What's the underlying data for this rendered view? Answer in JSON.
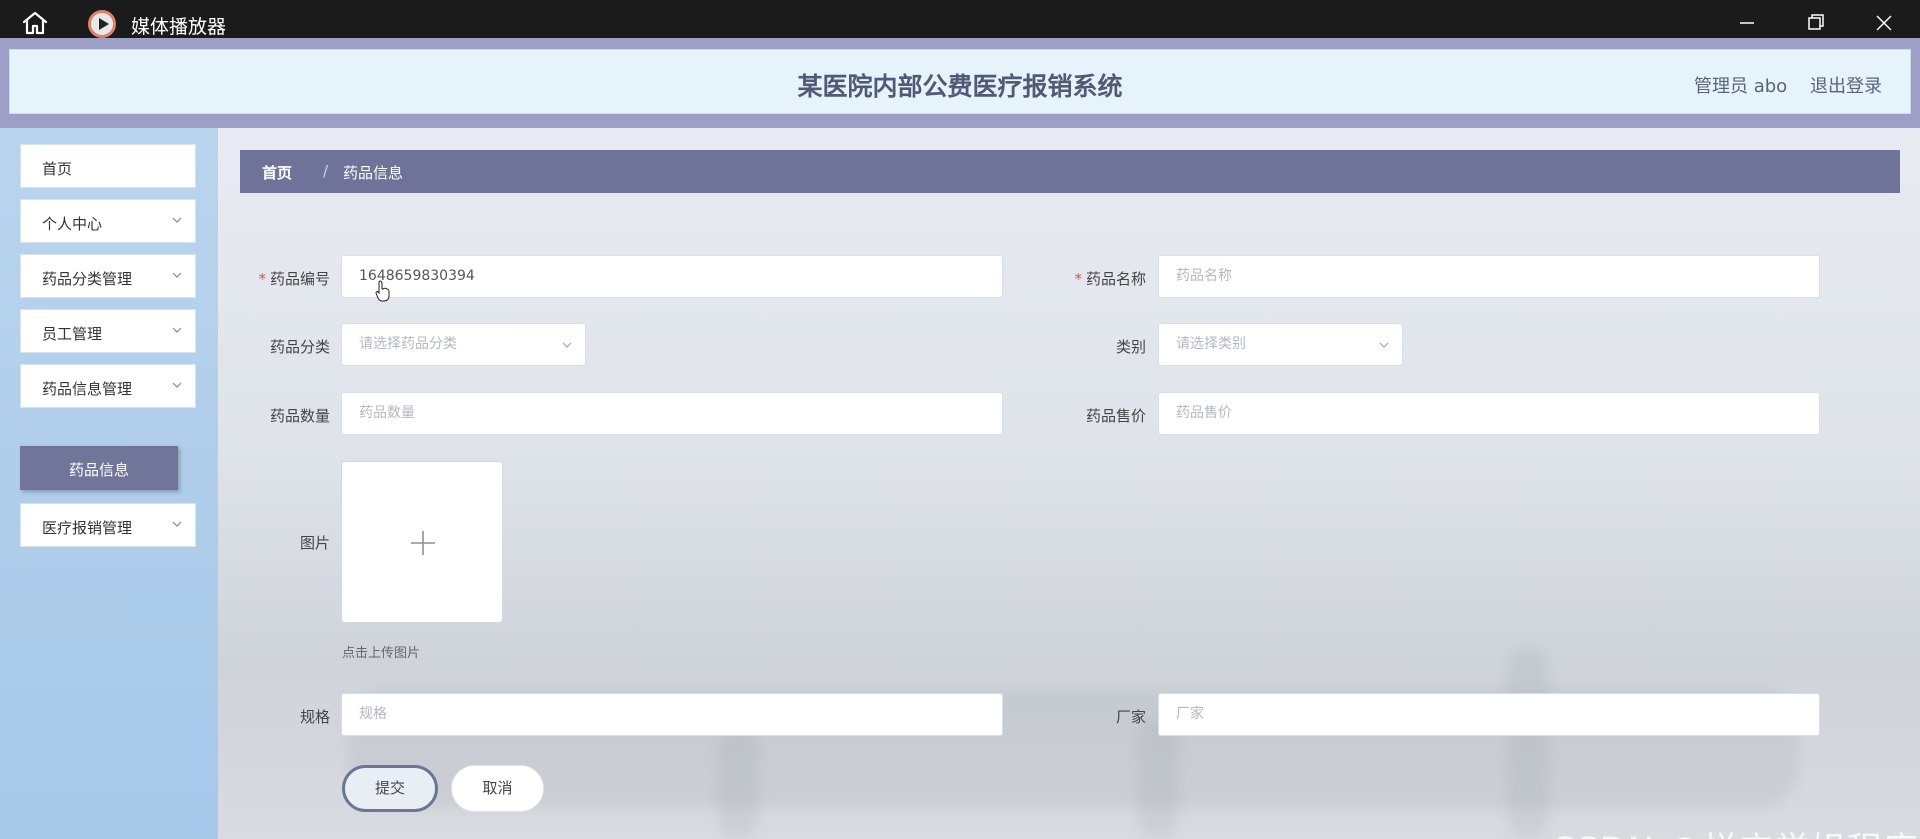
{
  "window": {
    "title": "媒体播放器",
    "icons": [
      "home-icon",
      "media-player-icon",
      "minimize-icon",
      "maximize-icon",
      "close-icon"
    ]
  },
  "header": {
    "title": "某医院内部公费医疗报销系统",
    "user": "管理员 abo",
    "logout": "退出登录"
  },
  "sidebar": {
    "items": [
      {
        "label": "首页",
        "has_children": false
      },
      {
        "label": "个人中心",
        "has_children": true
      },
      {
        "label": "药品分类管理",
        "has_children": true
      },
      {
        "label": "员工管理",
        "has_children": true
      },
      {
        "label": "药品信息管理",
        "has_children": true
      },
      {
        "label": "医疗报销管理",
        "has_children": true
      }
    ],
    "active_sub": "药品信息"
  },
  "breadcrumb": {
    "home": "首页",
    "separator": "/",
    "current": "药品信息"
  },
  "form": {
    "drug_code": {
      "label": "药品编号",
      "value": "1648659830394",
      "required": true
    },
    "drug_name": {
      "label": "药品名称",
      "placeholder": "药品名称",
      "required": true
    },
    "drug_category": {
      "label": "药品分类",
      "placeholder": "请选择药品分类"
    },
    "type": {
      "label": "类别",
      "placeholder": "请选择类别"
    },
    "quantity": {
      "label": "药品数量",
      "placeholder": "药品数量"
    },
    "price": {
      "label": "药品售价",
      "placeholder": "药品售价"
    },
    "image": {
      "label": "图片",
      "hint": "点击上传图片"
    },
    "spec": {
      "label": "规格",
      "placeholder": "规格"
    },
    "manufacturer": {
      "label": "厂家",
      "placeholder": "厂家"
    },
    "submit": "提交",
    "cancel": "取消"
  },
  "watermark": "CSDN @悦宁学姐程序",
  "colors": {
    "titlebar": "#1b1b1b",
    "frame": "#9d9fc6",
    "header_bg": "#e7f3fb",
    "sidebar_bg": "#b9d4ee",
    "breadcrumb_bg": "#6f7399",
    "active_sub_bg": "#717599",
    "required_star": "#e2534f"
  }
}
